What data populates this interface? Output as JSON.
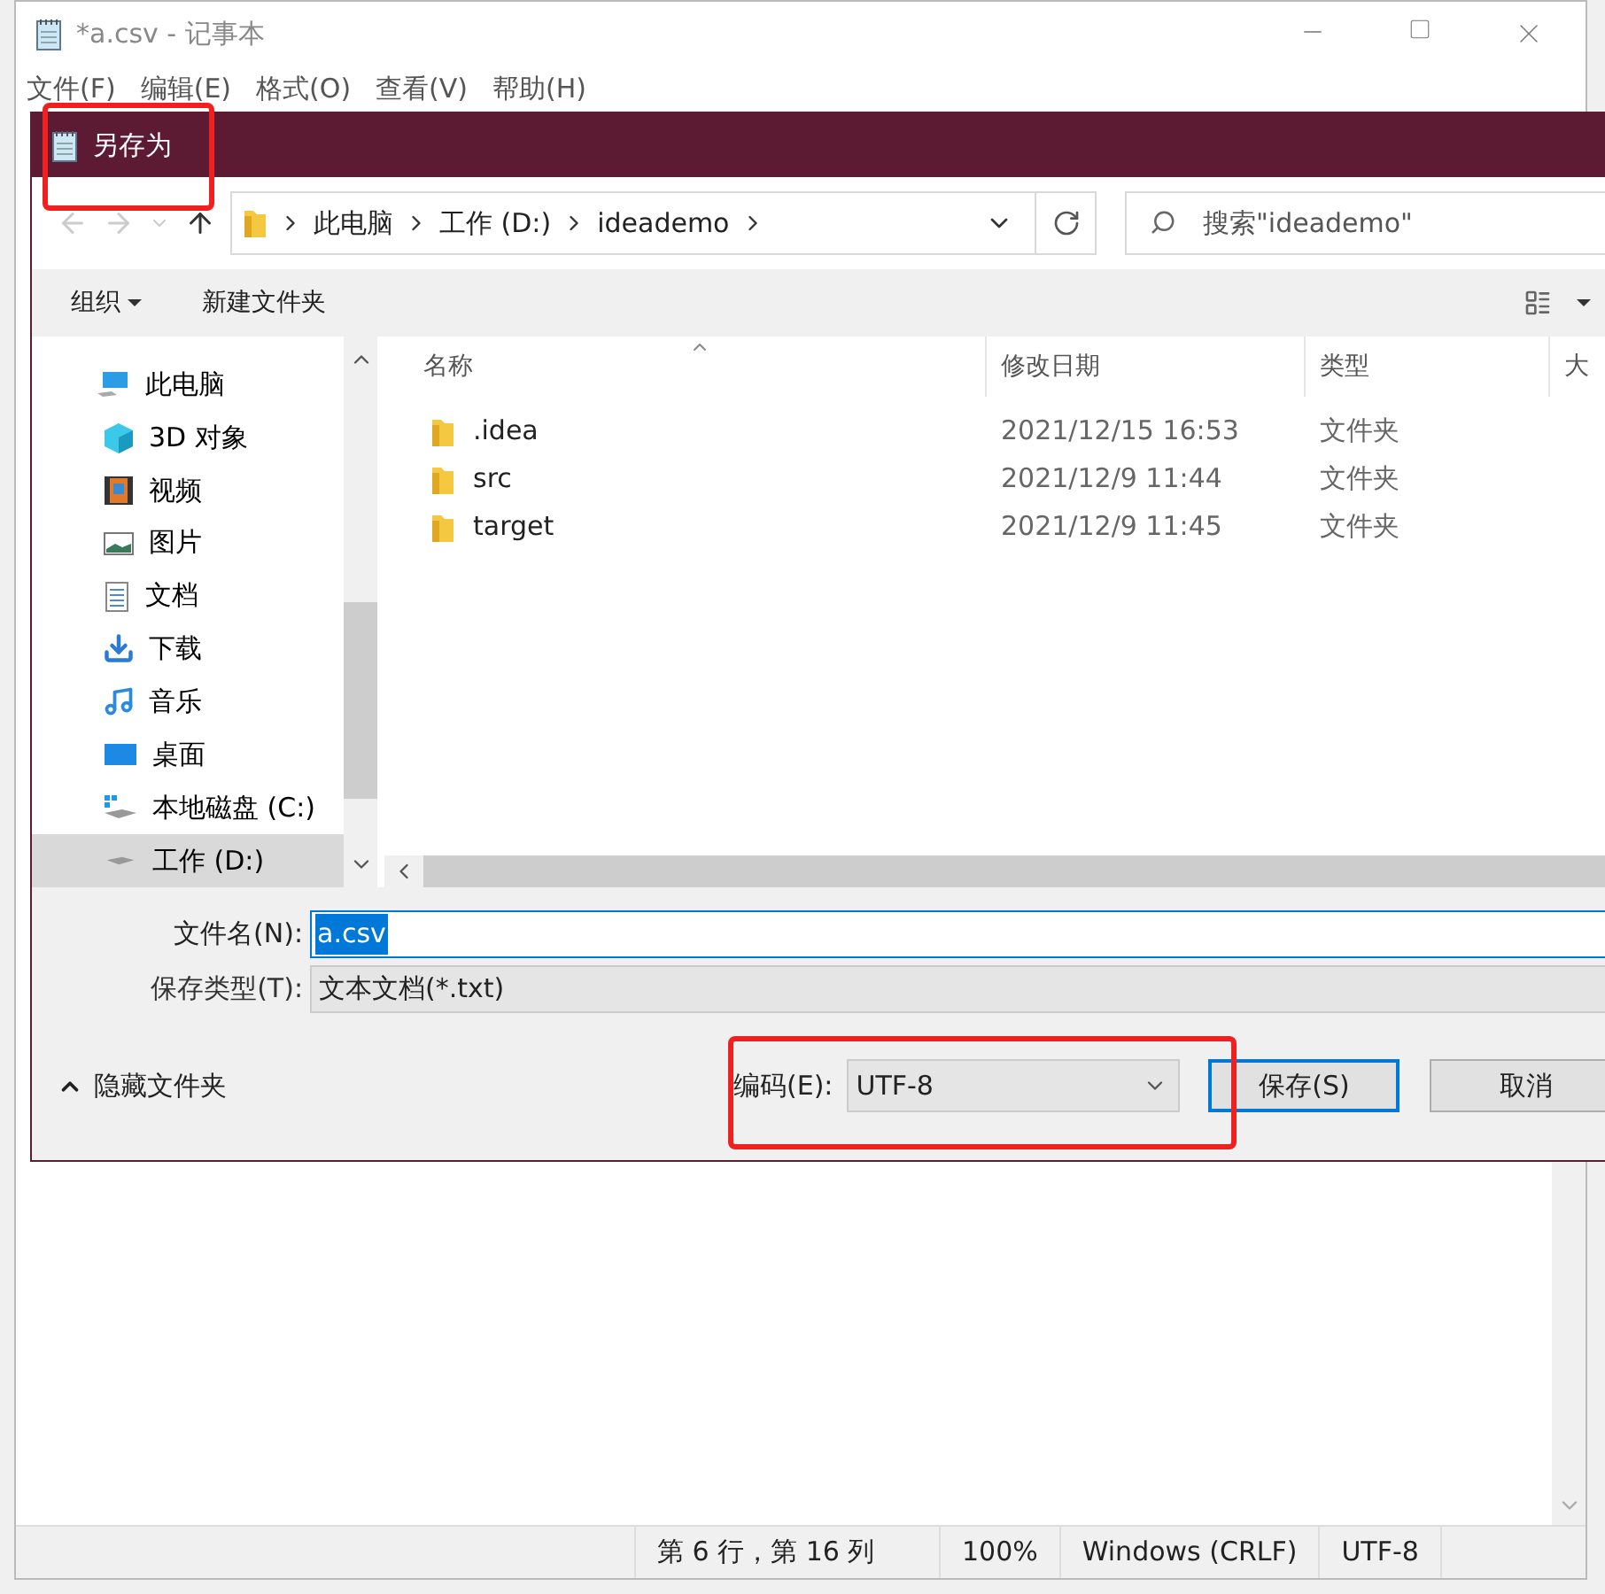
{
  "notepad": {
    "title": "*a.csv - 记事本",
    "menu": [
      "文件(F)",
      "编辑(E)",
      "格式(O)",
      "查看(V)",
      "帮助(H)"
    ],
    "status_bar": [
      "第 6 行，第 16 列",
      "100%",
      "Windows (CRLF)",
      "UTF-8"
    ]
  },
  "dialog": {
    "title": "另存为",
    "address": [
      "此电脑",
      "工作 (D:)",
      "ideademo"
    ],
    "search": {
      "placeholder": "搜索\"ideademo\""
    },
    "toolbar": [
      "组织",
      "新建文件夹"
    ],
    "sidebar": [
      {
        "label": "此电脑",
        "kind": "pc",
        "selected": false,
        "children": [
          {
            "label": "3D 对象",
            "kind": "cube",
            "selected": false
          },
          {
            "label": "视频",
            "kind": "film",
            "selected": false
          },
          {
            "label": "图片",
            "kind": "image",
            "selected": false
          },
          {
            "label": "文档",
            "kind": "doc",
            "selected": false
          },
          {
            "label": "下载",
            "kind": "download",
            "selected": false
          },
          {
            "label": "音乐",
            "kind": "music",
            "selected": false
          },
          {
            "label": "桌面",
            "kind": "desktop",
            "selected": false
          },
          {
            "label": "本地磁盘 (C:)",
            "kind": "drive",
            "selected": false
          },
          {
            "label": "工作 (D:)",
            "kind": "drive2",
            "selected": true
          }
        ]
      }
    ],
    "columns": [
      "名称",
      "修改日期",
      "类型",
      "大"
    ],
    "rows": [
      [
        ".idea",
        "2021/12/15 16:53",
        "文件夹"
      ],
      [
        "src",
        "2021/12/9 11:44",
        "文件夹"
      ],
      [
        "target",
        "2021/12/9 11:45",
        "文件夹"
      ]
    ],
    "filename_label": "文件名(N):",
    "filename": "a.csv",
    "type_label": "保存类型(T):",
    "type": "文本文档(*.txt)",
    "hide_folders": "隐藏文件夹",
    "encoding_label": "编码(E):",
    "encoding": "UTF-8",
    "buttons": [
      "保存(S)",
      "取消"
    ]
  }
}
